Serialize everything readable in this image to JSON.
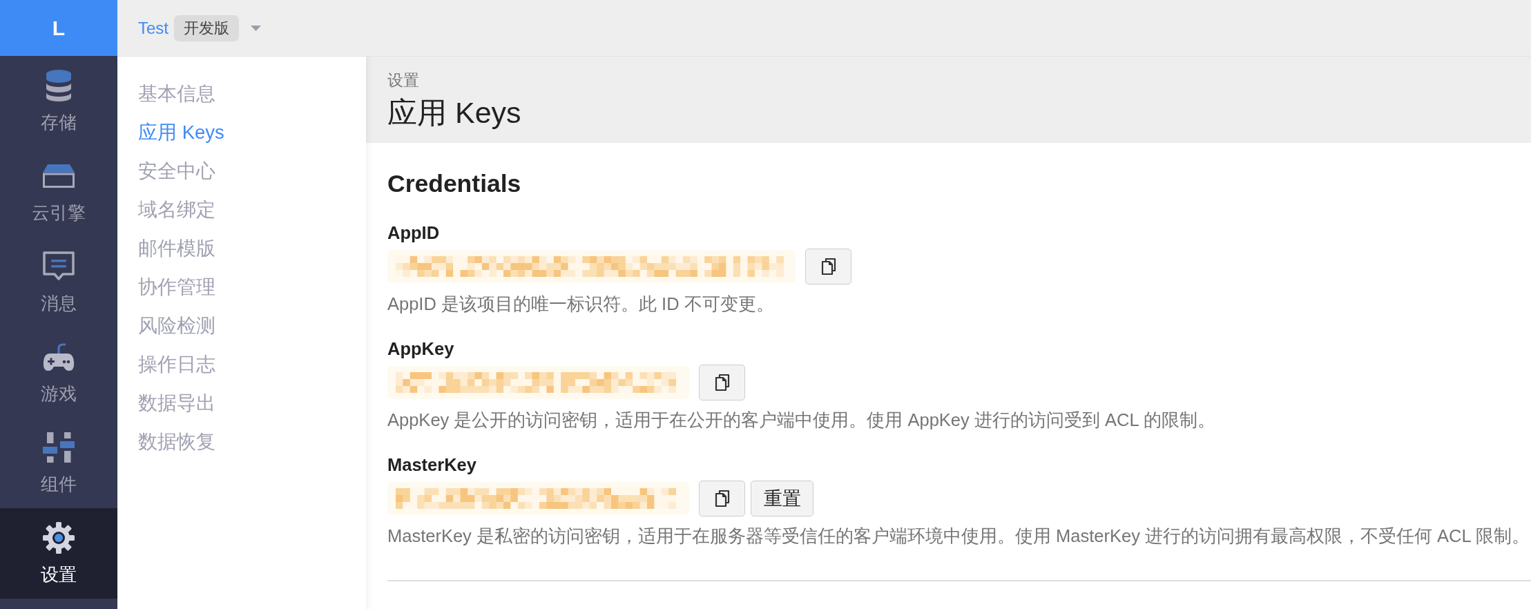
{
  "nav": {
    "logo": "L",
    "items": [
      {
        "label": "存储",
        "selected": false
      },
      {
        "label": "云引擎",
        "selected": false
      },
      {
        "label": "消息",
        "selected": false
      },
      {
        "label": "游戏",
        "selected": false
      },
      {
        "label": "组件",
        "selected": false
      },
      {
        "label": "设置",
        "selected": true
      }
    ]
  },
  "top_bar": {
    "app_name": "Test",
    "badge": "开发版"
  },
  "settings_menu": {
    "items": [
      {
        "label": "基本信息",
        "selected": false
      },
      {
        "label": "应用 Keys",
        "selected": true
      },
      {
        "label": "安全中心",
        "selected": false
      },
      {
        "label": "域名绑定",
        "selected": false
      },
      {
        "label": "邮件模版",
        "selected": false
      },
      {
        "label": "协作管理",
        "selected": false
      },
      {
        "label": "风险检测",
        "selected": false
      },
      {
        "label": "操作日志",
        "selected": false
      },
      {
        "label": "数据导出",
        "selected": false
      },
      {
        "label": "数据恢复",
        "selected": false
      }
    ]
  },
  "page_header": {
    "breadcrumb": "设置",
    "title": "应用 Keys"
  },
  "credentials": {
    "title": "Credentials",
    "items": [
      {
        "label": "AppID",
        "description": "AppID 是该项目的唯一标识符。此 ID 不可变更。",
        "buttons": [
          {
            "kind": "copy"
          }
        ]
      },
      {
        "label": "AppKey",
        "description": "AppKey 是公开的访问密钥，适用于在公开的客户端中使用。使用 AppKey 进行的访问受到 ACL 的限制。",
        "buttons": [
          {
            "kind": "copy"
          }
        ]
      },
      {
        "label": "MasterKey",
        "description": "MasterKey 是私密的访问密钥，适用于在服务器等受信任的客户端环境中使用。使用 MasterKey 进行的访问拥有最高权限，不受任何 ACL 限制。",
        "buttons": [
          {
            "kind": "copy"
          },
          {
            "kind": "reset",
            "label": "重置"
          }
        ]
      }
    ]
  }
}
